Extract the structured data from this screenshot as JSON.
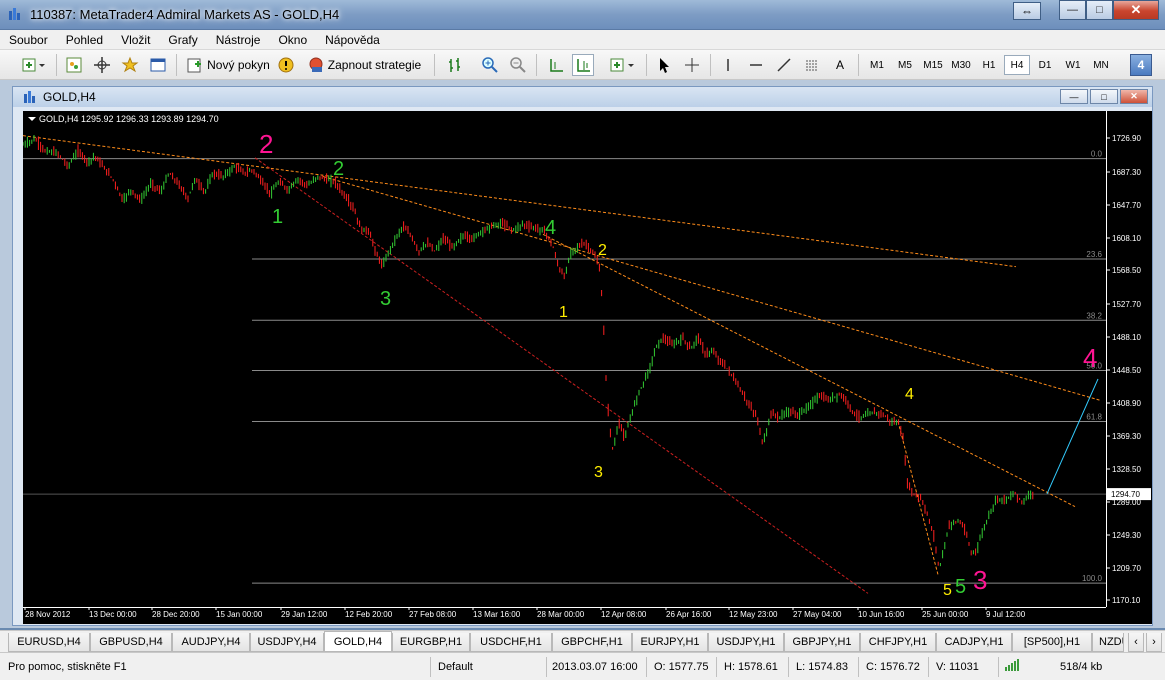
{
  "window": {
    "title": "110387: MetaTrader4 Admiral Markets AS - GOLD,H4",
    "minimize": "—",
    "maximize": "□",
    "close": "✕",
    "restore": "⇔"
  },
  "menu": [
    "Soubor",
    "Pohled",
    "Vložit",
    "Grafy",
    "Nástroje",
    "Okno",
    "Nápověda"
  ],
  "toolbar": {
    "new_order": "Nový pokyn",
    "auto_trading": "Zapnout strategie",
    "timeframes": [
      "M1",
      "M5",
      "M15",
      "M30",
      "H1",
      "H4",
      "D1",
      "W1",
      "MN"
    ],
    "active_timeframe": "H4",
    "text_tool": "A",
    "badge": "4"
  },
  "chart_window": {
    "title": "GOLD,H4"
  },
  "chart_data": {
    "type": "line",
    "symbol_info": "GOLD,H4  1295.92 1296.33 1293.89 1294.70",
    "symbol": "GOLD,H4",
    "ohlc": {
      "open": 1295.92,
      "high": 1296.33,
      "low": 1293.89,
      "close": 1294.7
    },
    "current_price": "1294.70",
    "y_ticks": [
      "1726.90",
      "1687.30",
      "1647.70",
      "1608.10",
      "1568.50",
      "1527.70",
      "1488.10",
      "1448.50",
      "1408.90",
      "1369.30",
      "1328.50",
      "1289.00",
      "1249.30",
      "1209.70",
      "1170.10"
    ],
    "x_ticks": [
      "28 Nov 2012",
      "13 Dec 00:00",
      "28 Dec 20:00",
      "15 Jan 00:00",
      "29 Jan 12:00",
      "12 Feb 20:00",
      "27 Feb 08:00",
      "13 Mar 16:00",
      "28 Mar 00:00",
      "12 Apr 08:00",
      "26 Apr 16:00",
      "12 May 23:00",
      "27 May 04:00",
      "10 Jun 16:00",
      "25 Jun 00:00",
      "9 Jul 12:00"
    ],
    "ylim": [
      1162,
      1745
    ],
    "fib_levels": [
      {
        "label": "0.0",
        "price": 1689
      },
      {
        "label": "23.6",
        "price": 1571
      },
      {
        "label": "38.2",
        "price": 1499
      },
      {
        "label": "50.0",
        "price": 1440
      },
      {
        "label": "61.8",
        "price": 1380
      },
      {
        "label": "100.0",
        "price": 1190
      }
    ],
    "price_path": [
      [
        0,
        1705
      ],
      [
        12,
        1712
      ],
      [
        22,
        1698
      ],
      [
        35,
        1695
      ],
      [
        45,
        1680
      ],
      [
        55,
        1698
      ],
      [
        65,
        1685
      ],
      [
        72,
        1692
      ],
      [
        80,
        1680
      ],
      [
        90,
        1665
      ],
      [
        100,
        1640
      ],
      [
        108,
        1652
      ],
      [
        118,
        1640
      ],
      [
        128,
        1660
      ],
      [
        138,
        1650
      ],
      [
        146,
        1672
      ],
      [
        155,
        1660
      ],
      [
        165,
        1642
      ],
      [
        172,
        1665
      ],
      [
        182,
        1650
      ],
      [
        190,
        1672
      ],
      [
        200,
        1668
      ],
      [
        212,
        1680
      ],
      [
        222,
        1672
      ],
      [
        230,
        1676
      ],
      [
        240,
        1660
      ],
      [
        248,
        1648
      ],
      [
        256,
        1662
      ],
      [
        265,
        1652
      ],
      [
        275,
        1665
      ],
      [
        285,
        1657
      ],
      [
        295,
        1668
      ],
      [
        305,
        1664
      ],
      [
        312,
        1662
      ],
      [
        320,
        1648
      ],
      [
        330,
        1632
      ],
      [
        338,
        1606
      ],
      [
        346,
        1604
      ],
      [
        354,
        1575
      ],
      [
        360,
        1563
      ],
      [
        366,
        1580
      ],
      [
        374,
        1598
      ],
      [
        380,
        1610
      ],
      [
        388,
        1598
      ],
      [
        396,
        1580
      ],
      [
        404,
        1590
      ],
      [
        412,
        1580
      ],
      [
        420,
        1595
      ],
      [
        430,
        1585
      ],
      [
        440,
        1598
      ],
      [
        450,
        1595
      ],
      [
        460,
        1605
      ],
      [
        470,
        1610
      ],
      [
        480,
        1613
      ],
      [
        490,
        1605
      ],
      [
        500,
        1612
      ],
      [
        510,
        1608
      ],
      [
        520,
        1605
      ],
      [
        525,
        1598
      ],
      [
        530,
        1585
      ],
      [
        536,
        1560
      ],
      [
        542,
        1550
      ],
      [
        548,
        1580
      ],
      [
        555,
        1585
      ],
      [
        562,
        1590
      ],
      [
        570,
        1578
      ],
      [
        576,
        1565
      ],
      [
        580,
        1510
      ],
      [
        583,
        1430
      ],
      [
        586,
        1380
      ],
      [
        590,
        1345
      ],
      [
        596,
        1380
      ],
      [
        602,
        1360
      ],
      [
        610,
        1395
      ],
      [
        618,
        1420
      ],
      [
        626,
        1440
      ],
      [
        634,
        1470
      ],
      [
        640,
        1478
      ],
      [
        650,
        1470
      ],
      [
        660,
        1478
      ],
      [
        668,
        1465
      ],
      [
        675,
        1480
      ],
      [
        682,
        1460
      ],
      [
        690,
        1462
      ],
      [
        698,
        1450
      ],
      [
        706,
        1440
      ],
      [
        716,
        1420
      ],
      [
        726,
        1400
      ],
      [
        734,
        1385
      ],
      [
        740,
        1352
      ],
      [
        748,
        1390
      ],
      [
        756,
        1385
      ],
      [
        766,
        1392
      ],
      [
        776,
        1388
      ],
      [
        786,
        1398
      ],
      [
        796,
        1410
      ],
      [
        806,
        1405
      ],
      [
        816,
        1412
      ],
      [
        824,
        1405
      ],
      [
        830,
        1390
      ],
      [
        838,
        1385
      ],
      [
        848,
        1390
      ],
      [
        858,
        1390
      ],
      [
        868,
        1380
      ],
      [
        876,
        1378
      ],
      [
        880,
        1360
      ],
      [
        884,
        1310
      ],
      [
        890,
        1295
      ],
      [
        898,
        1290
      ],
      [
        906,
        1265
      ],
      [
        912,
        1240
      ],
      [
        916,
        1206
      ],
      [
        920,
        1225
      ],
      [
        926,
        1258
      ],
      [
        932,
        1262
      ],
      [
        938,
        1262
      ],
      [
        944,
        1245
      ],
      [
        948,
        1225
      ],
      [
        954,
        1230
      ],
      [
        960,
        1252
      ],
      [
        966,
        1270
      ],
      [
        974,
        1290
      ],
      [
        982,
        1288
      ],
      [
        992,
        1295
      ],
      [
        1000,
        1285
      ],
      [
        1008,
        1296
      ],
      [
        1012,
        1294
      ]
    ],
    "wave_labels": [
      {
        "text": "2",
        "color": "#ff1493",
        "size": "large"
      },
      {
        "text": "2",
        "color": "#33cc33",
        "size": "medium"
      },
      {
        "text": "1",
        "color": "#33cc33",
        "size": "medium"
      },
      {
        "text": "3",
        "color": "#33cc33",
        "size": "medium"
      },
      {
        "text": "4",
        "color": "#33cc33",
        "size": "medium"
      },
      {
        "text": "2",
        "color": "#ffee00",
        "size": "small"
      },
      {
        "text": "1",
        "color": "#ffee00",
        "size": "small"
      },
      {
        "text": "3",
        "color": "#ffee00",
        "size": "small"
      },
      {
        "text": "4",
        "color": "#ffee00",
        "size": "small"
      },
      {
        "text": "5",
        "color": "#ffee00",
        "size": "small"
      },
      {
        "text": "5",
        "color": "#33cc33",
        "size": "medium"
      },
      {
        "text": "3",
        "color": "#ff1493",
        "size": "large"
      },
      {
        "text": "4",
        "color": "#ff1493",
        "size": "large"
      }
    ],
    "colors": {
      "bull": "#33cc33",
      "bear": "#ff2020",
      "grid": "#3a3a3a",
      "fib": "#8a8a8a",
      "trend": "#ff8c1a",
      "channel": "#cc2020",
      "projection": "#33ccff"
    }
  },
  "symbol_tabs": [
    "EURUSD,H4",
    "GBPUSD,H4",
    "AUDJPY,H4",
    "USDJPY,H4",
    "GOLD,H4",
    "EURGBP,H1",
    "USDCHF,H1",
    "GBPCHF,H1",
    "EURJPY,H1",
    "USDJPY,H1",
    "GBPJPY,H1",
    "CHFJPY,H1",
    "CADJPY,H1",
    "[SP500],H1",
    "NZDU"
  ],
  "active_tab": "GOLD,H4",
  "status": {
    "help": "Pro pomoc, stiskněte F1",
    "profile": "Default",
    "datetime": "2013.03.07 16:00",
    "open": "O: 1577.75",
    "high": "H: 1578.61",
    "low": "L: 1574.83",
    "close": "C: 1576.72",
    "volume": "V: 11031",
    "traffic": "518/4 kb"
  }
}
